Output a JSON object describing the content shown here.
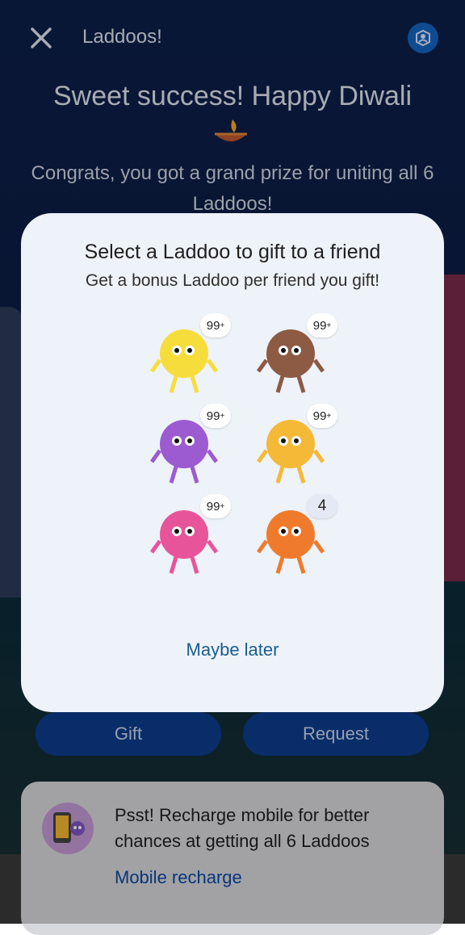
{
  "header": {
    "title": "Laddoos!"
  },
  "hero": {
    "headline": "Sweet success! Happy Diwali",
    "message": "Congrats, you got a grand prize for uniting all 6 Laddoos!"
  },
  "modal": {
    "title": "Select a Laddoo to gift to a friend",
    "subtitle": "Get a bonus Laddoo per friend you gift!",
    "laddoos": [
      {
        "name": "yellow-laddoo",
        "count": "99",
        "color": "#f7dd3b",
        "plus": "+"
      },
      {
        "name": "brown-laddoo",
        "count": "99",
        "color": "#8d5a44",
        "plus": "+"
      },
      {
        "name": "purple-laddoo",
        "count": "99",
        "color": "#9c5bd1",
        "plus": "+"
      },
      {
        "name": "orange-sunglasses-laddoo",
        "count": "99",
        "color": "#f5b938",
        "plus": "+"
      },
      {
        "name": "pink-laddoo",
        "count": "99",
        "color": "#e8549a",
        "plus": "+"
      },
      {
        "name": "orange-laddoo",
        "count": "4",
        "color": "#f07a2c",
        "plus": ""
      }
    ],
    "dismiss_label": "Maybe later"
  },
  "actions": {
    "gift_label": "Gift",
    "request_label": "Request"
  },
  "promo": {
    "text": "Psst! Recharge mobile for better chances at getting all 6 Laddoos",
    "link_label": "Mobile recharge"
  },
  "colors": {
    "accent": "#1565c0",
    "modal_bg": "#eef2f9",
    "link": "#1b5e8f"
  }
}
